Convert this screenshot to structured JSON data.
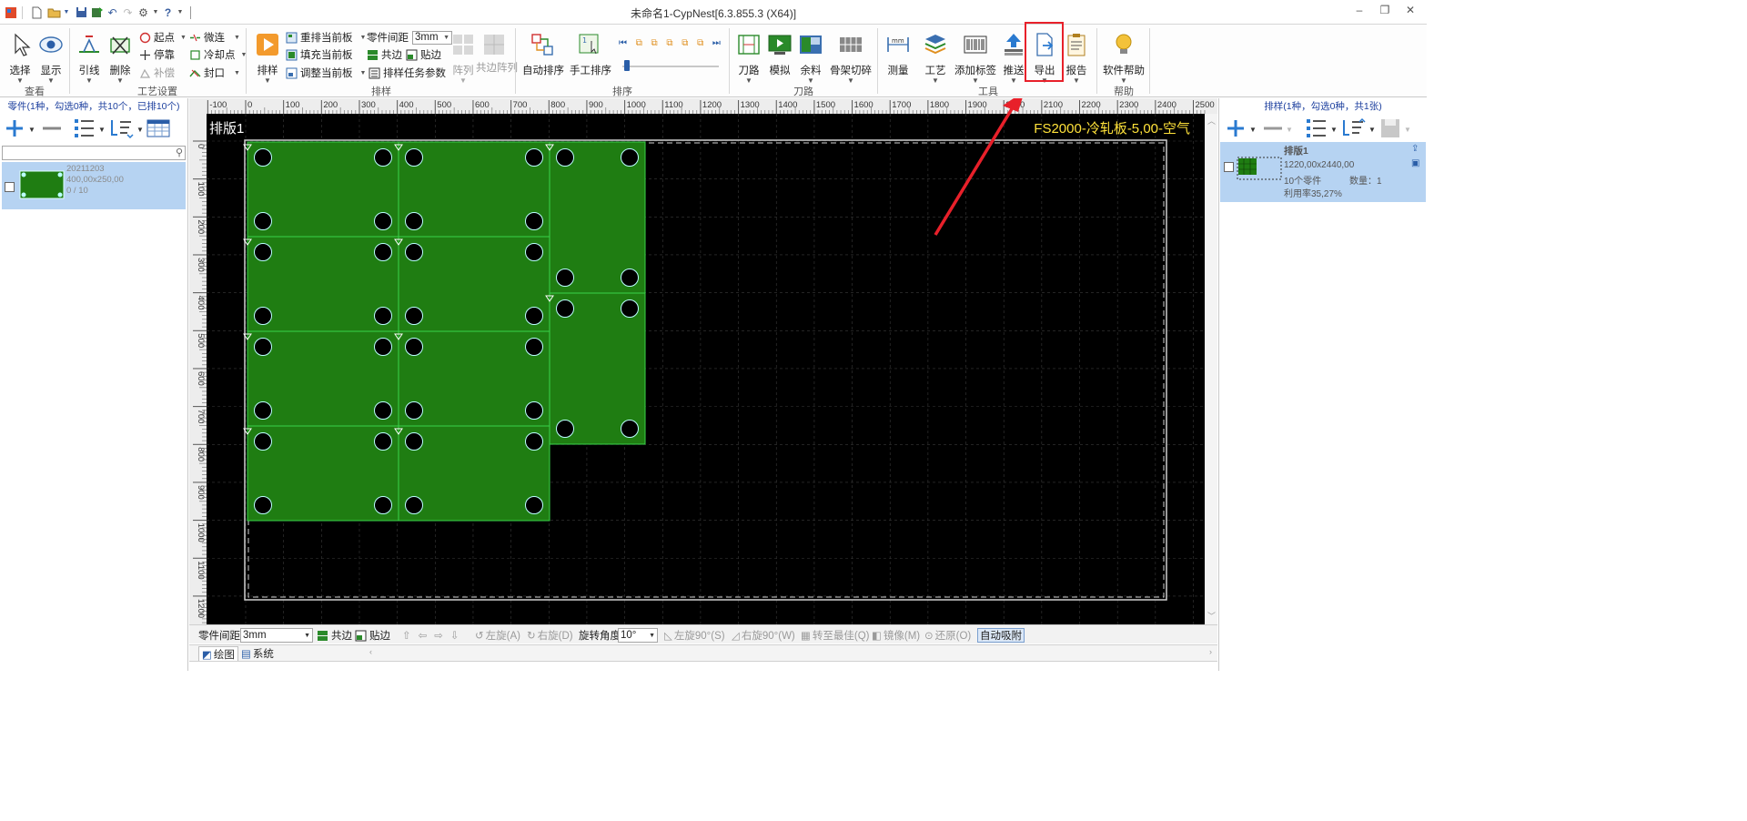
{
  "window": {
    "title": "未命名1-CypNest[6.3.855.3 (X64)]",
    "minimize": "–",
    "restore": "❐",
    "close": "✕"
  },
  "ribbon": {
    "view": {
      "label": "查看",
      "select": "选择",
      "display": "显示"
    },
    "process": {
      "label": "工艺设置",
      "lead": "引线",
      "delete": "删除",
      "start_point": "起点",
      "micro_joint": "微连",
      "stop_point": "停靠",
      "cooling_point": "冷却点",
      "compensation": "补偿",
      "seal": "封口"
    },
    "nest": {
      "label": "排样",
      "nest_btn": "排样",
      "renest_current": "重排当前板",
      "fill_current": "填充当前板",
      "adjust_current": "调整当前板",
      "part_spacing_label": "零件间距",
      "part_spacing_value": "3mm",
      "common_edge": "共边",
      "stick_edge": "贴边",
      "nest_params": "排样任务参数",
      "array": "阵列",
      "common_edge_array": "共边阵列"
    },
    "sort": {
      "label": "排序",
      "auto_sort": "自动排序",
      "manual_sort": "手工排序"
    },
    "toolpath": {
      "label": "刀路",
      "toolpath_btn": "刀路",
      "simulate": "模拟",
      "remnant": "余料",
      "skeleton_cut": "骨架切碎"
    },
    "tools": {
      "label": "工具",
      "measure": "测量",
      "technology": "工艺",
      "add_label": "添加标签",
      "push": "推送",
      "export": "导出",
      "report": "报告"
    },
    "help": {
      "label": "帮助",
      "software_help": "软件帮助"
    }
  },
  "left_panel": {
    "title": "零件(1种，勾选0种，共10个，已排10个)",
    "part": {
      "name": "20211203",
      "size": "400,00x250,00",
      "count": "0 / 10"
    }
  },
  "right_panel": {
    "title": "排样(1种，勾选0种，共1张)",
    "sheet": {
      "name": "排版1",
      "size": "1220,00x2440,00",
      "parts": "10个零件",
      "qty": "数量：1",
      "utilization": "利用率35,27%"
    }
  },
  "canvas": {
    "sheet_label": "排版1",
    "machine_info": "FS2000-冷轧板-5,00-空气",
    "ruler_top": [
      "-100",
      "0",
      "100",
      "200",
      "300",
      "400",
      "500",
      "600",
      "700",
      "800",
      "900",
      "1000",
      "1100",
      "1200",
      "1300",
      "1400",
      "1500",
      "1600",
      "1700",
      "1800",
      "1900",
      "2000",
      "2100",
      "2200",
      "2300",
      "2400",
      "2500"
    ],
    "ruler_left": [
      "0",
      "100",
      "200",
      "300",
      "400",
      "500",
      "600",
      "700",
      "800",
      "900",
      "1000",
      "1100",
      "1200"
    ]
  },
  "bottom_bar": {
    "part_spacing_label": "零件间距",
    "part_spacing_value": "3mm",
    "common_edge": "共边",
    "stick_edge": "贴边",
    "rotate_left": "左旋(A)",
    "rotate_right": "右旋(D)",
    "rotate_angle_label": "旋转角度",
    "rotate_angle_value": "10°",
    "left_rotate_90": "左旋90°(S)",
    "right_rotate_90": "右旋90°(W)",
    "rotate_best": "转至最佳(Q)",
    "mirror": "镜像(M)",
    "restore": "还原(O)",
    "auto_snap": "自动吸附"
  },
  "bottom_tabs": {
    "draw": "绘图",
    "system": "系统"
  },
  "colors": {
    "part_green": "#1f7d12",
    "highlight_red": "#e8202a",
    "panel_title_blue": "#1c3f9e",
    "machine_yellow": "#ffe23a"
  }
}
